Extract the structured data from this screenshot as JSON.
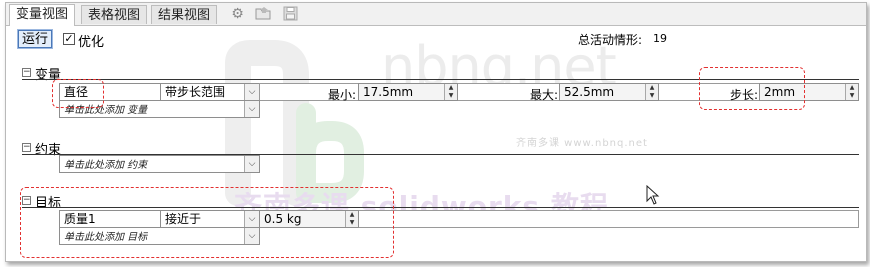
{
  "tabs": [
    {
      "label": "变量视图",
      "active": true
    },
    {
      "label": "表格视图",
      "active": false
    },
    {
      "label": "结果视图",
      "active": false
    }
  ],
  "toolbar_icons": [
    "gear-icon",
    "folder-open-icon",
    "save-icon"
  ],
  "run_label": "运行",
  "optimize": {
    "label": "优化",
    "checked": true
  },
  "stats": {
    "label": "总活动情形:",
    "value": "19"
  },
  "variables": {
    "title": "变量",
    "row": {
      "name": "直径",
      "type": "带步长范围",
      "min_label": "最小:",
      "min_value": "17.5mm",
      "max_label": "最大:",
      "max_value": "52.5mm",
      "step_label": "步长:",
      "step_value": "2mm"
    },
    "add_text": "单击此处添加 变量"
  },
  "constraints": {
    "title": "约束",
    "add_text": "单击此处添加 约束"
  },
  "goals": {
    "title": "目标",
    "row": {
      "name": "质量1",
      "condition": "接近于",
      "value": "0.5 kg"
    },
    "add_text": "单击此处添加 目标"
  },
  "watermark": {
    "brand": "nbnq.net",
    "tagline": "齐南多课  www.nbnq.net",
    "course": "齐南多课 solidworks 教程"
  },
  "colors": {
    "highlight": "#e23030",
    "accent": "#4a78b8"
  }
}
